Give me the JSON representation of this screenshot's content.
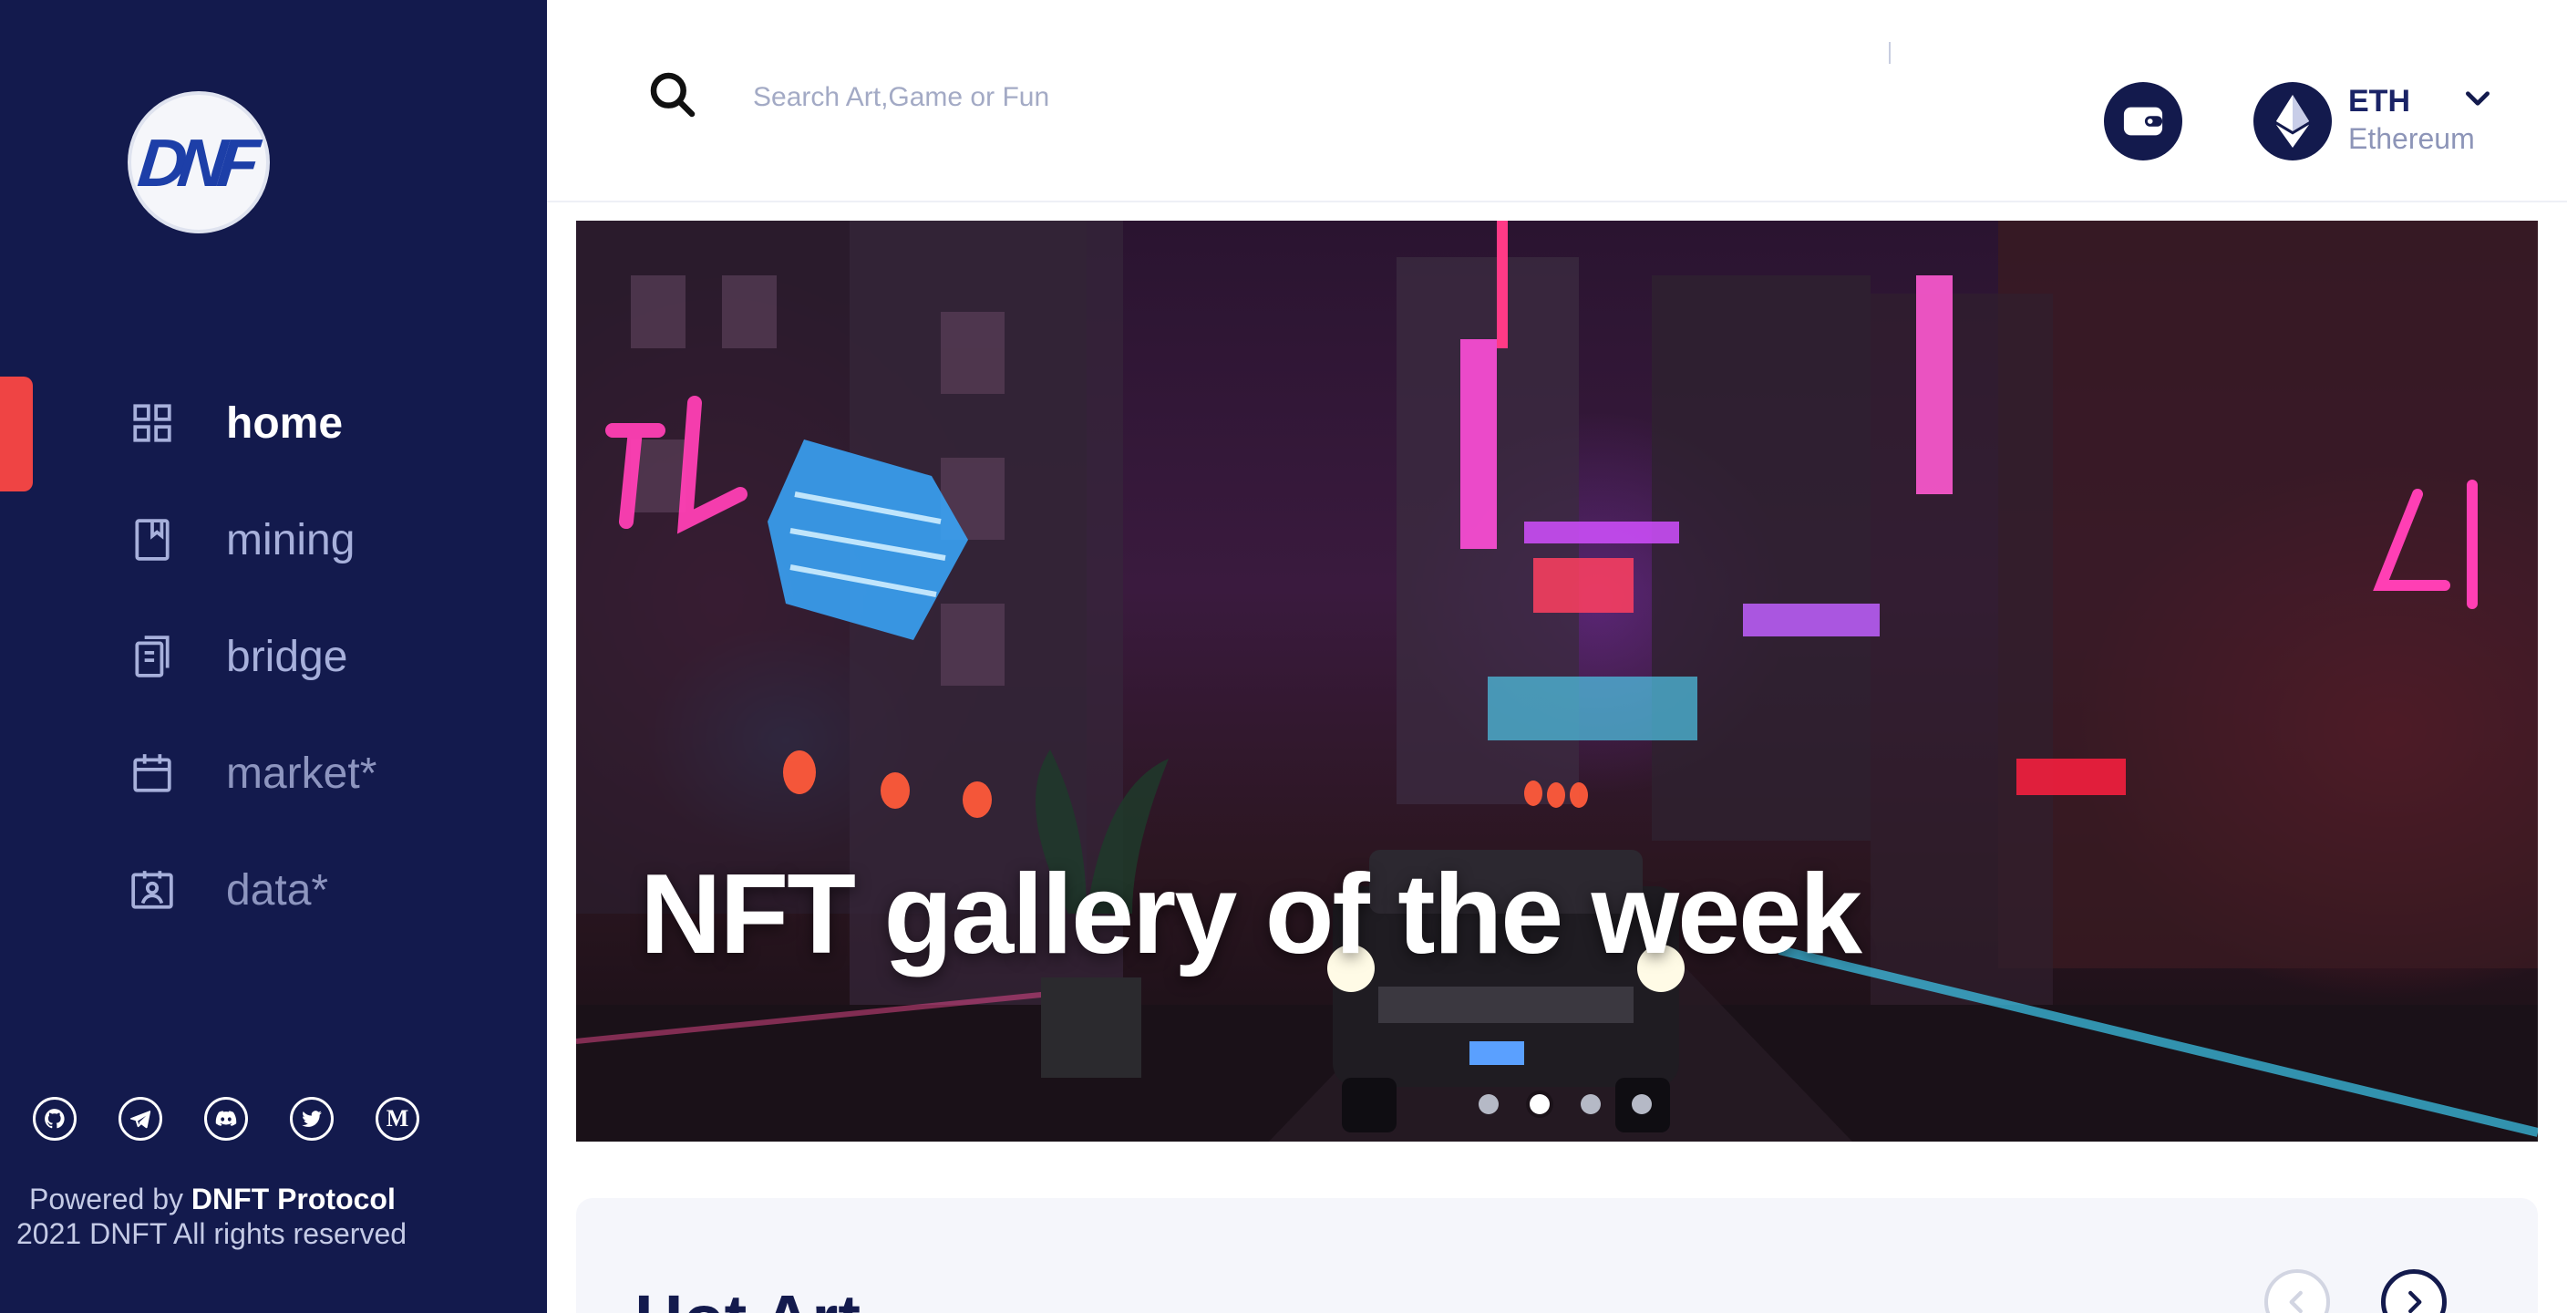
{
  "brand": {
    "logo_text": "DNF"
  },
  "nav": {
    "items": [
      {
        "label": "home",
        "icon": "grid-icon",
        "active": true
      },
      {
        "label": "mining",
        "icon": "bookmark-icon",
        "active": false
      },
      {
        "label": "bridge",
        "icon": "clipboard-icon",
        "active": false
      },
      {
        "label": "market*",
        "icon": "calendar-icon",
        "active": false
      },
      {
        "label": "data*",
        "icon": "id-card-icon",
        "active": false
      }
    ]
  },
  "social": [
    {
      "name": "github-icon"
    },
    {
      "name": "telegram-icon"
    },
    {
      "name": "discord-icon"
    },
    {
      "name": "twitter-icon"
    },
    {
      "name": "medium-icon",
      "glyph": "M"
    }
  ],
  "footer": {
    "powered_prefix": "Powered by",
    "powered_brand": "DNFT Protocol",
    "copyright": "2021 DNFT All rights reserved"
  },
  "search": {
    "placeholder": "Search Art,Game or Fun",
    "value": ""
  },
  "network": {
    "symbol": "ETH",
    "name": "Ethereum"
  },
  "banner": {
    "title": "NFT gallery of the week",
    "slides": 4,
    "active_slide": 2
  },
  "hot_art": {
    "title": "Hot Art"
  },
  "colors": {
    "sidebar_bg": "#131a4d",
    "accent_red": "#ef4444",
    "text_dark": "#131a4d"
  }
}
